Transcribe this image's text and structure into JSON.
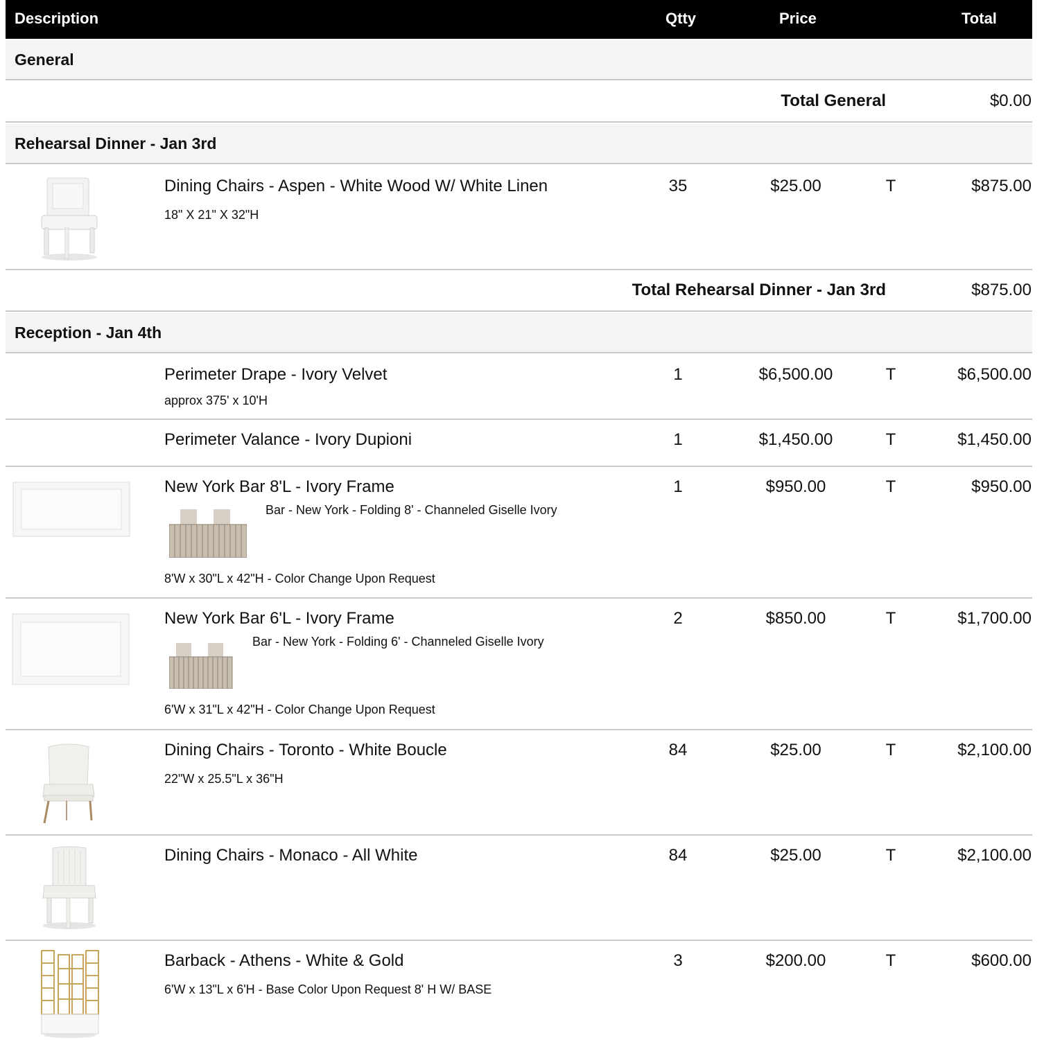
{
  "header": {
    "description": "Description",
    "qty": "Qtty",
    "price": "Price",
    "total": "Total"
  },
  "sections": {
    "general": {
      "title": "General",
      "total_label": "Total General",
      "total": "$0.00"
    },
    "rehearsal": {
      "title": "Rehearsal Dinner - Jan 3rd",
      "total_label": "Total Rehearsal Dinner - Jan 3rd",
      "total": "$875.00"
    },
    "reception": {
      "title": "Reception - Jan 4th"
    }
  },
  "items": [
    {
      "name": "Dining Chairs - Aspen - White Wood W/ White Linen",
      "detail": "18\" X 21\" X 32\"H",
      "qty": "35",
      "price": "$25.00",
      "tax": "T",
      "total": "$875.00",
      "image": "chair-aspen"
    },
    {
      "name": "Perimeter Drape - Ivory Velvet",
      "detail": "approx 375' x 10'H",
      "qty": "1",
      "price": "$6,500.00",
      "tax": "T",
      "total": "$6,500.00"
    },
    {
      "name": "Perimeter Valance - Ivory Dupioni",
      "qty": "1",
      "price": "$1,450.00",
      "tax": "T",
      "total": "$1,450.00"
    },
    {
      "name": "New York Bar 8'L - Ivory Frame",
      "option": "Bar - New York -  Folding 8' - Channeled Giselle Ivory",
      "detail": "8'W x 30\"L x 42\"H - Color Change Upon Request",
      "qty": "1",
      "price": "$950.00",
      "tax": "T",
      "total": "$950.00",
      "image": "bar-frame"
    },
    {
      "name": "New York Bar 6'L - Ivory Frame",
      "option": "Bar - New York - Folding 6' - Channeled Giselle Ivory",
      "detail": "6'W x 31\"L x  42\"H - Color Change Upon Request",
      "qty": "2",
      "price": "$850.00",
      "tax": "T",
      "total": "$1,700.00",
      "image": "bar-frame"
    },
    {
      "name": "Dining Chairs - Toronto - White Boucle",
      "detail": "22\"W x 25.5\"L x 36\"H",
      "qty": "84",
      "price": "$25.00",
      "tax": "T",
      "total": "$2,100.00",
      "image": "chair-toronto"
    },
    {
      "name": "Dining Chairs - Monaco - All White",
      "qty": "84",
      "price": "$25.00",
      "tax": "T",
      "total": "$2,100.00",
      "image": "chair-monaco"
    },
    {
      "name": "Barback - Athens - White & Gold",
      "detail": "6'W x 13\"L x 6'H - Base Color Upon Request 8' H W/ BASE",
      "qty": "3",
      "price": "$200.00",
      "tax": "T",
      "total": "$600.00",
      "image": "barback-athens"
    }
  ]
}
